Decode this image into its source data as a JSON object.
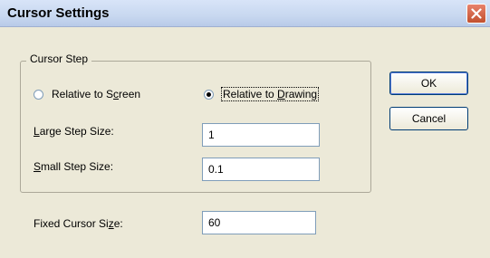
{
  "window": {
    "title": "Cursor Settings"
  },
  "cursor_step": {
    "group_label": "Cursor Step",
    "radio_screen": {
      "before": "Relative to S",
      "mnemonic": "c",
      "after": "reen",
      "checked": false
    },
    "radio_drawing": {
      "before": "Relative to ",
      "mnemonic": "D",
      "after": "rawing",
      "checked": true
    },
    "large_step": {
      "mnemonic": "L",
      "after": "arge Step Size:",
      "value": "1"
    },
    "small_step": {
      "mnemonic": "S",
      "after": "mall Step Size:",
      "value": "0.1"
    }
  },
  "fixed_cursor": {
    "before": "Fixed Cursor Si",
    "mnemonic": "z",
    "after": "e:",
    "value": "60"
  },
  "buttons": {
    "ok": "OK",
    "cancel": "Cancel"
  },
  "icons": {
    "close": "close-icon"
  },
  "colors": {
    "title_bg": "#c8d8f0",
    "dialog_bg": "#ece9d8",
    "close_red": "#c1502e"
  }
}
